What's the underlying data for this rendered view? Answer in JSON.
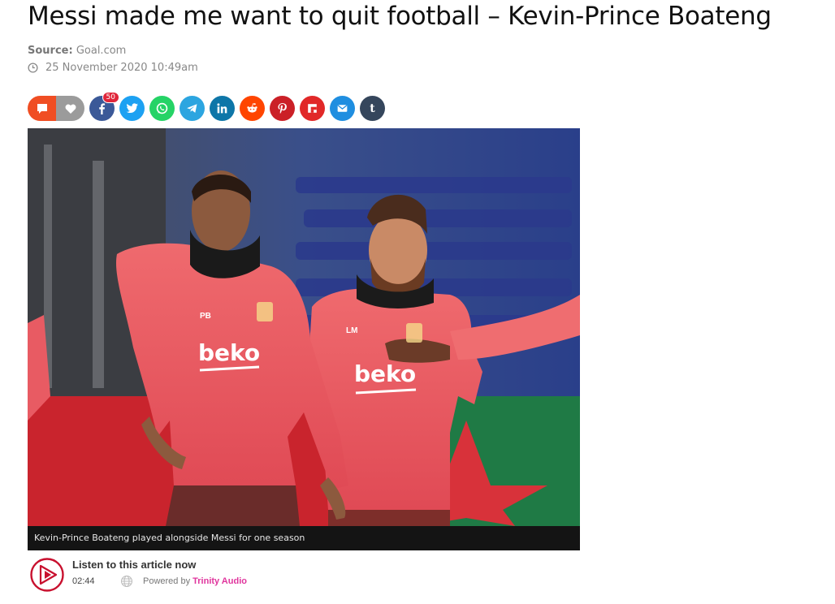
{
  "article": {
    "title": "Messi made me want to quit football – Kevin-Prince Boateng",
    "source_label": "Source:",
    "source_value": "Goal.com",
    "date": "25 November 2020 10:49am"
  },
  "share": {
    "facebook_count": "50",
    "tumblr_letter": "t",
    "buttons": [
      "comment-icon",
      "heart-icon",
      "facebook-icon",
      "twitter-icon",
      "whatsapp-icon",
      "telegram-icon",
      "linkedin-icon",
      "reddit-icon",
      "pinterest-icon",
      "flipboard-icon",
      "email-icon",
      "tumblr-icon"
    ],
    "colors": {
      "comment": "#f04e23",
      "heart": "#9b9b9b",
      "facebook": "#3b5998",
      "twitter": "#1da1f2",
      "whatsapp": "#25d366",
      "telegram": "#2ca5e0",
      "linkedin": "#0e76a8",
      "reddit": "#ff4500",
      "pinterest": "#cb2027",
      "flipboard": "#e12828",
      "email": "#1f8ee0",
      "tumblr": "#35465c"
    }
  },
  "image": {
    "caption": "Kevin-Prince Boateng played alongside Messi for one season",
    "shirt_text_left": "beko",
    "shirt_text_right": "beko",
    "initials_left": "PB",
    "initials_right": "LM"
  },
  "audio_player": {
    "listen_label": "Listen to this article now",
    "duration": "02:44",
    "powered_by": "Powered by",
    "brand": "Trinity Audio"
  }
}
